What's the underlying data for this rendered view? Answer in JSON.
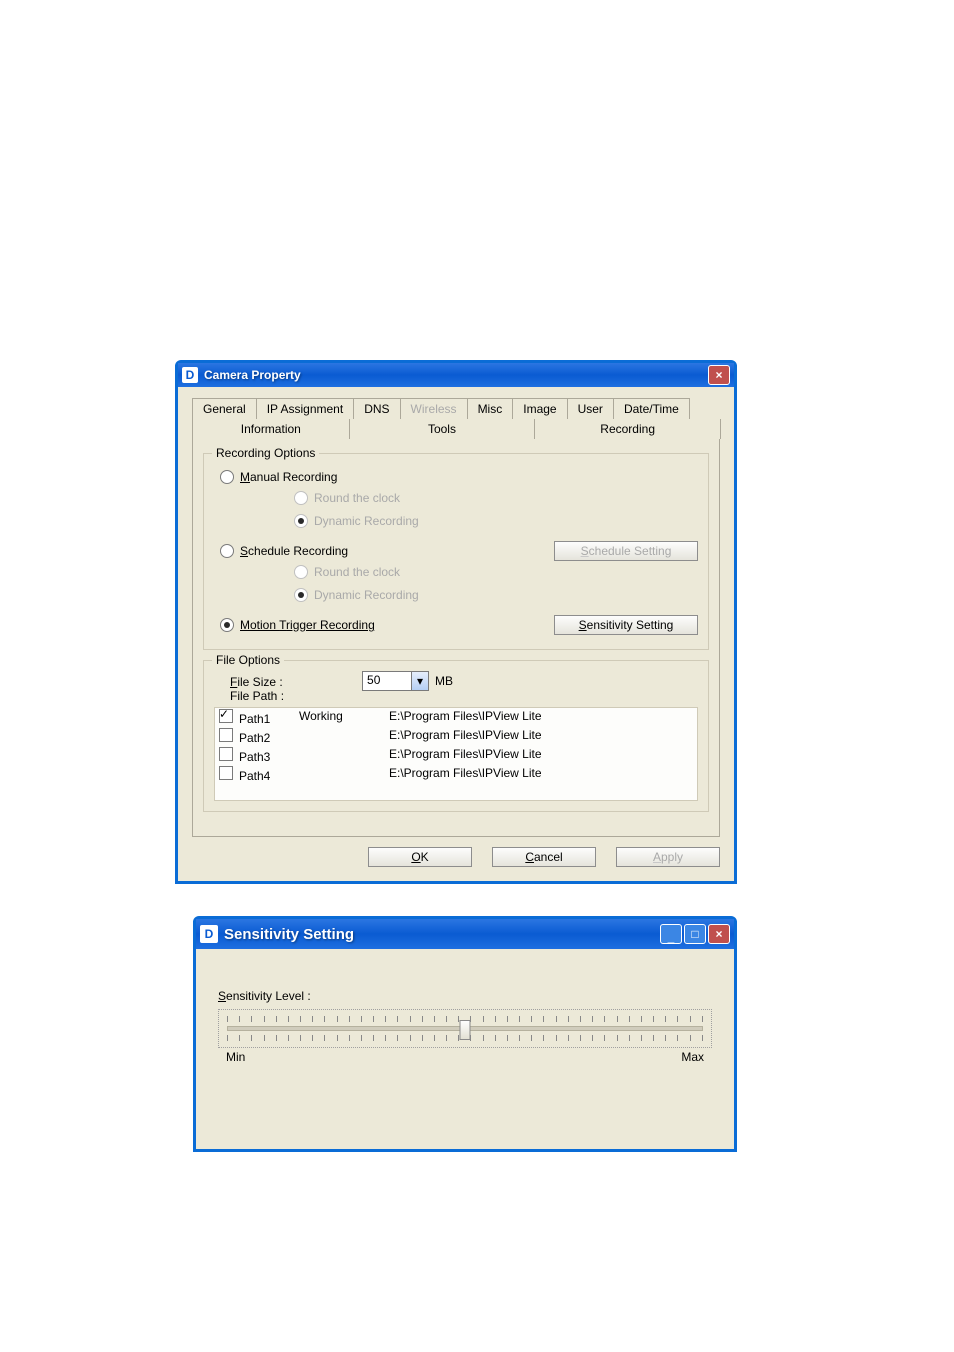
{
  "window1": {
    "icon_letter": "D",
    "title": "Camera Property",
    "tabs_row1": [
      "General",
      "IP Assignment",
      "DNS",
      "Wireless",
      "Misc",
      "Image",
      "User",
      "Date/Time"
    ],
    "tabs_row1_disabled_index": 3,
    "tabs_row2": [
      "Information",
      "Tools",
      "Recording"
    ],
    "recording": {
      "legend": "Recording Options",
      "manual": {
        "label": "Manual Recording",
        "opt1": "Round the clock",
        "opt2": "Dynamic Recording"
      },
      "schedule": {
        "label": "Schedule Recording",
        "opt1": "Round the clock",
        "opt2": "Dynamic Recording",
        "btn": "Schedule Setting"
      },
      "motion": {
        "label": "Motion Trigger Recording",
        "btn": "Sensitivity Setting"
      }
    },
    "file": {
      "legend": "File Options",
      "size_label": "File Size :",
      "size_value": "50",
      "size_unit": "MB",
      "path_label": "File Path :",
      "rows": [
        {
          "name": "Path1",
          "checked": true,
          "status": "Working",
          "path": "E:\\Program Files\\IPView Lite"
        },
        {
          "name": "Path2",
          "checked": false,
          "status": "",
          "path": "E:\\Program Files\\IPView Lite"
        },
        {
          "name": "Path3",
          "checked": false,
          "status": "",
          "path": "E:\\Program Files\\IPView Lite"
        },
        {
          "name": "Path4",
          "checked": false,
          "status": "",
          "path": "E:\\Program Files\\IPView Lite"
        }
      ]
    },
    "buttons": {
      "ok": "OK",
      "cancel": "Cancel",
      "apply": "Apply"
    }
  },
  "window2": {
    "icon_letter": "D",
    "title": "Sensitivity Setting",
    "label": "Sensitivity Level :",
    "min": "Min",
    "max": "Max"
  }
}
